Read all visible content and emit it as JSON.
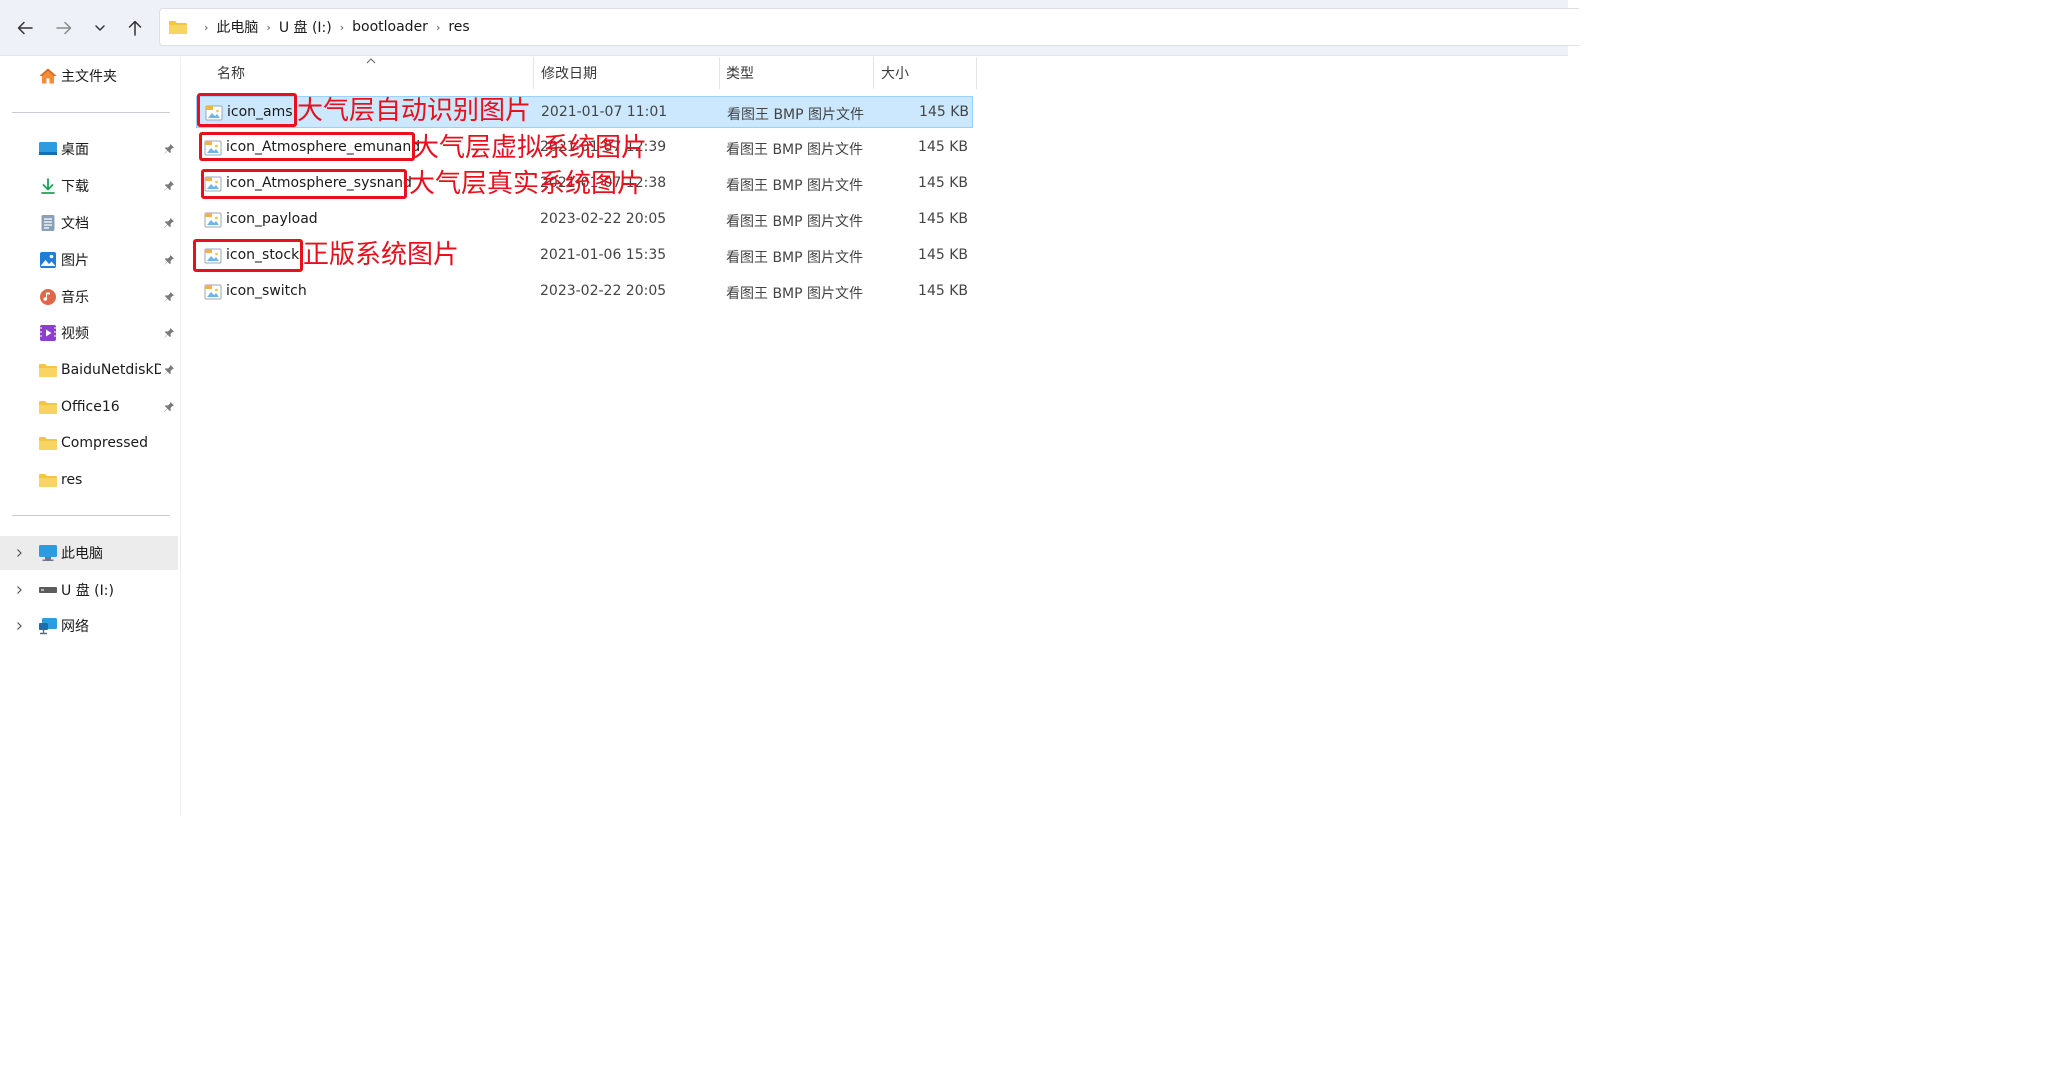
{
  "nav": {
    "back_icon": "arrow-left-icon",
    "forward_icon": "arrow-right-icon",
    "recent_icon": "chevron-down-icon",
    "up_icon": "arrow-up-icon"
  },
  "breadcrumb": [
    "此电脑",
    "U 盘 (I:)",
    "bootloader",
    "res"
  ],
  "sidebar": {
    "home": "主文件夹",
    "quick_access": [
      {
        "label": "桌面",
        "icon": "desktop-icon",
        "pinned": true
      },
      {
        "label": "下载",
        "icon": "download-icon",
        "pinned": true
      },
      {
        "label": "文档",
        "icon": "document-icon",
        "pinned": true
      },
      {
        "label": "图片",
        "icon": "pictures-icon",
        "pinned": true
      },
      {
        "label": "音乐",
        "icon": "music-icon",
        "pinned": true
      },
      {
        "label": "视频",
        "icon": "video-icon",
        "pinned": true
      },
      {
        "label": "BaiduNetdiskD",
        "icon": "folder-icon",
        "pinned": true
      },
      {
        "label": "Office16",
        "icon": "folder-icon",
        "pinned": true
      },
      {
        "label": "Compressed",
        "icon": "folder-icon",
        "pinned": false
      },
      {
        "label": "res",
        "icon": "folder-icon",
        "pinned": false
      }
    ],
    "locations": [
      {
        "label": "此电脑",
        "icon": "computer-icon"
      },
      {
        "label": "U 盘 (I:)",
        "icon": "usb-drive-icon"
      },
      {
        "label": "网络",
        "icon": "network-icon"
      }
    ]
  },
  "columns": {
    "name": "名称",
    "date": "修改日期",
    "type": "类型",
    "size": "大小"
  },
  "files": [
    {
      "name": "icon_ams",
      "date": "2021-01-07 11:01",
      "type": "看图王 BMP 图片文件",
      "size": "145 KB"
    },
    {
      "name": "icon_Atmosphere_emunand",
      "date": "2021-01-07 12:39",
      "type": "看图王 BMP 图片文件",
      "size": "145 KB"
    },
    {
      "name": "icon_Atmosphere_sysnand",
      "date": "2021-01-07 12:38",
      "type": "看图王 BMP 图片文件",
      "size": "145 KB"
    },
    {
      "name": "icon_payload",
      "date": "2023-02-22 20:05",
      "type": "看图王 BMP 图片文件",
      "size": "145 KB"
    },
    {
      "name": "icon_stock",
      "date": "2021-01-06 15:35",
      "type": "看图王 BMP 图片文件",
      "size": "145 KB"
    },
    {
      "name": "icon_switch",
      "date": "2023-02-22 20:05",
      "type": "看图王 BMP 图片文件",
      "size": "145 KB"
    }
  ],
  "annotations": [
    {
      "text": "大气层自动识别图片"
    },
    {
      "text": "大气层虚拟系统图片"
    },
    {
      "text": "大气层真实系统图片"
    },
    {
      "text": "正版系统图片"
    }
  ],
  "colors": {
    "annotation": "#e8101c",
    "selected_row": "#cce8ff",
    "folder": "#f4c542"
  }
}
